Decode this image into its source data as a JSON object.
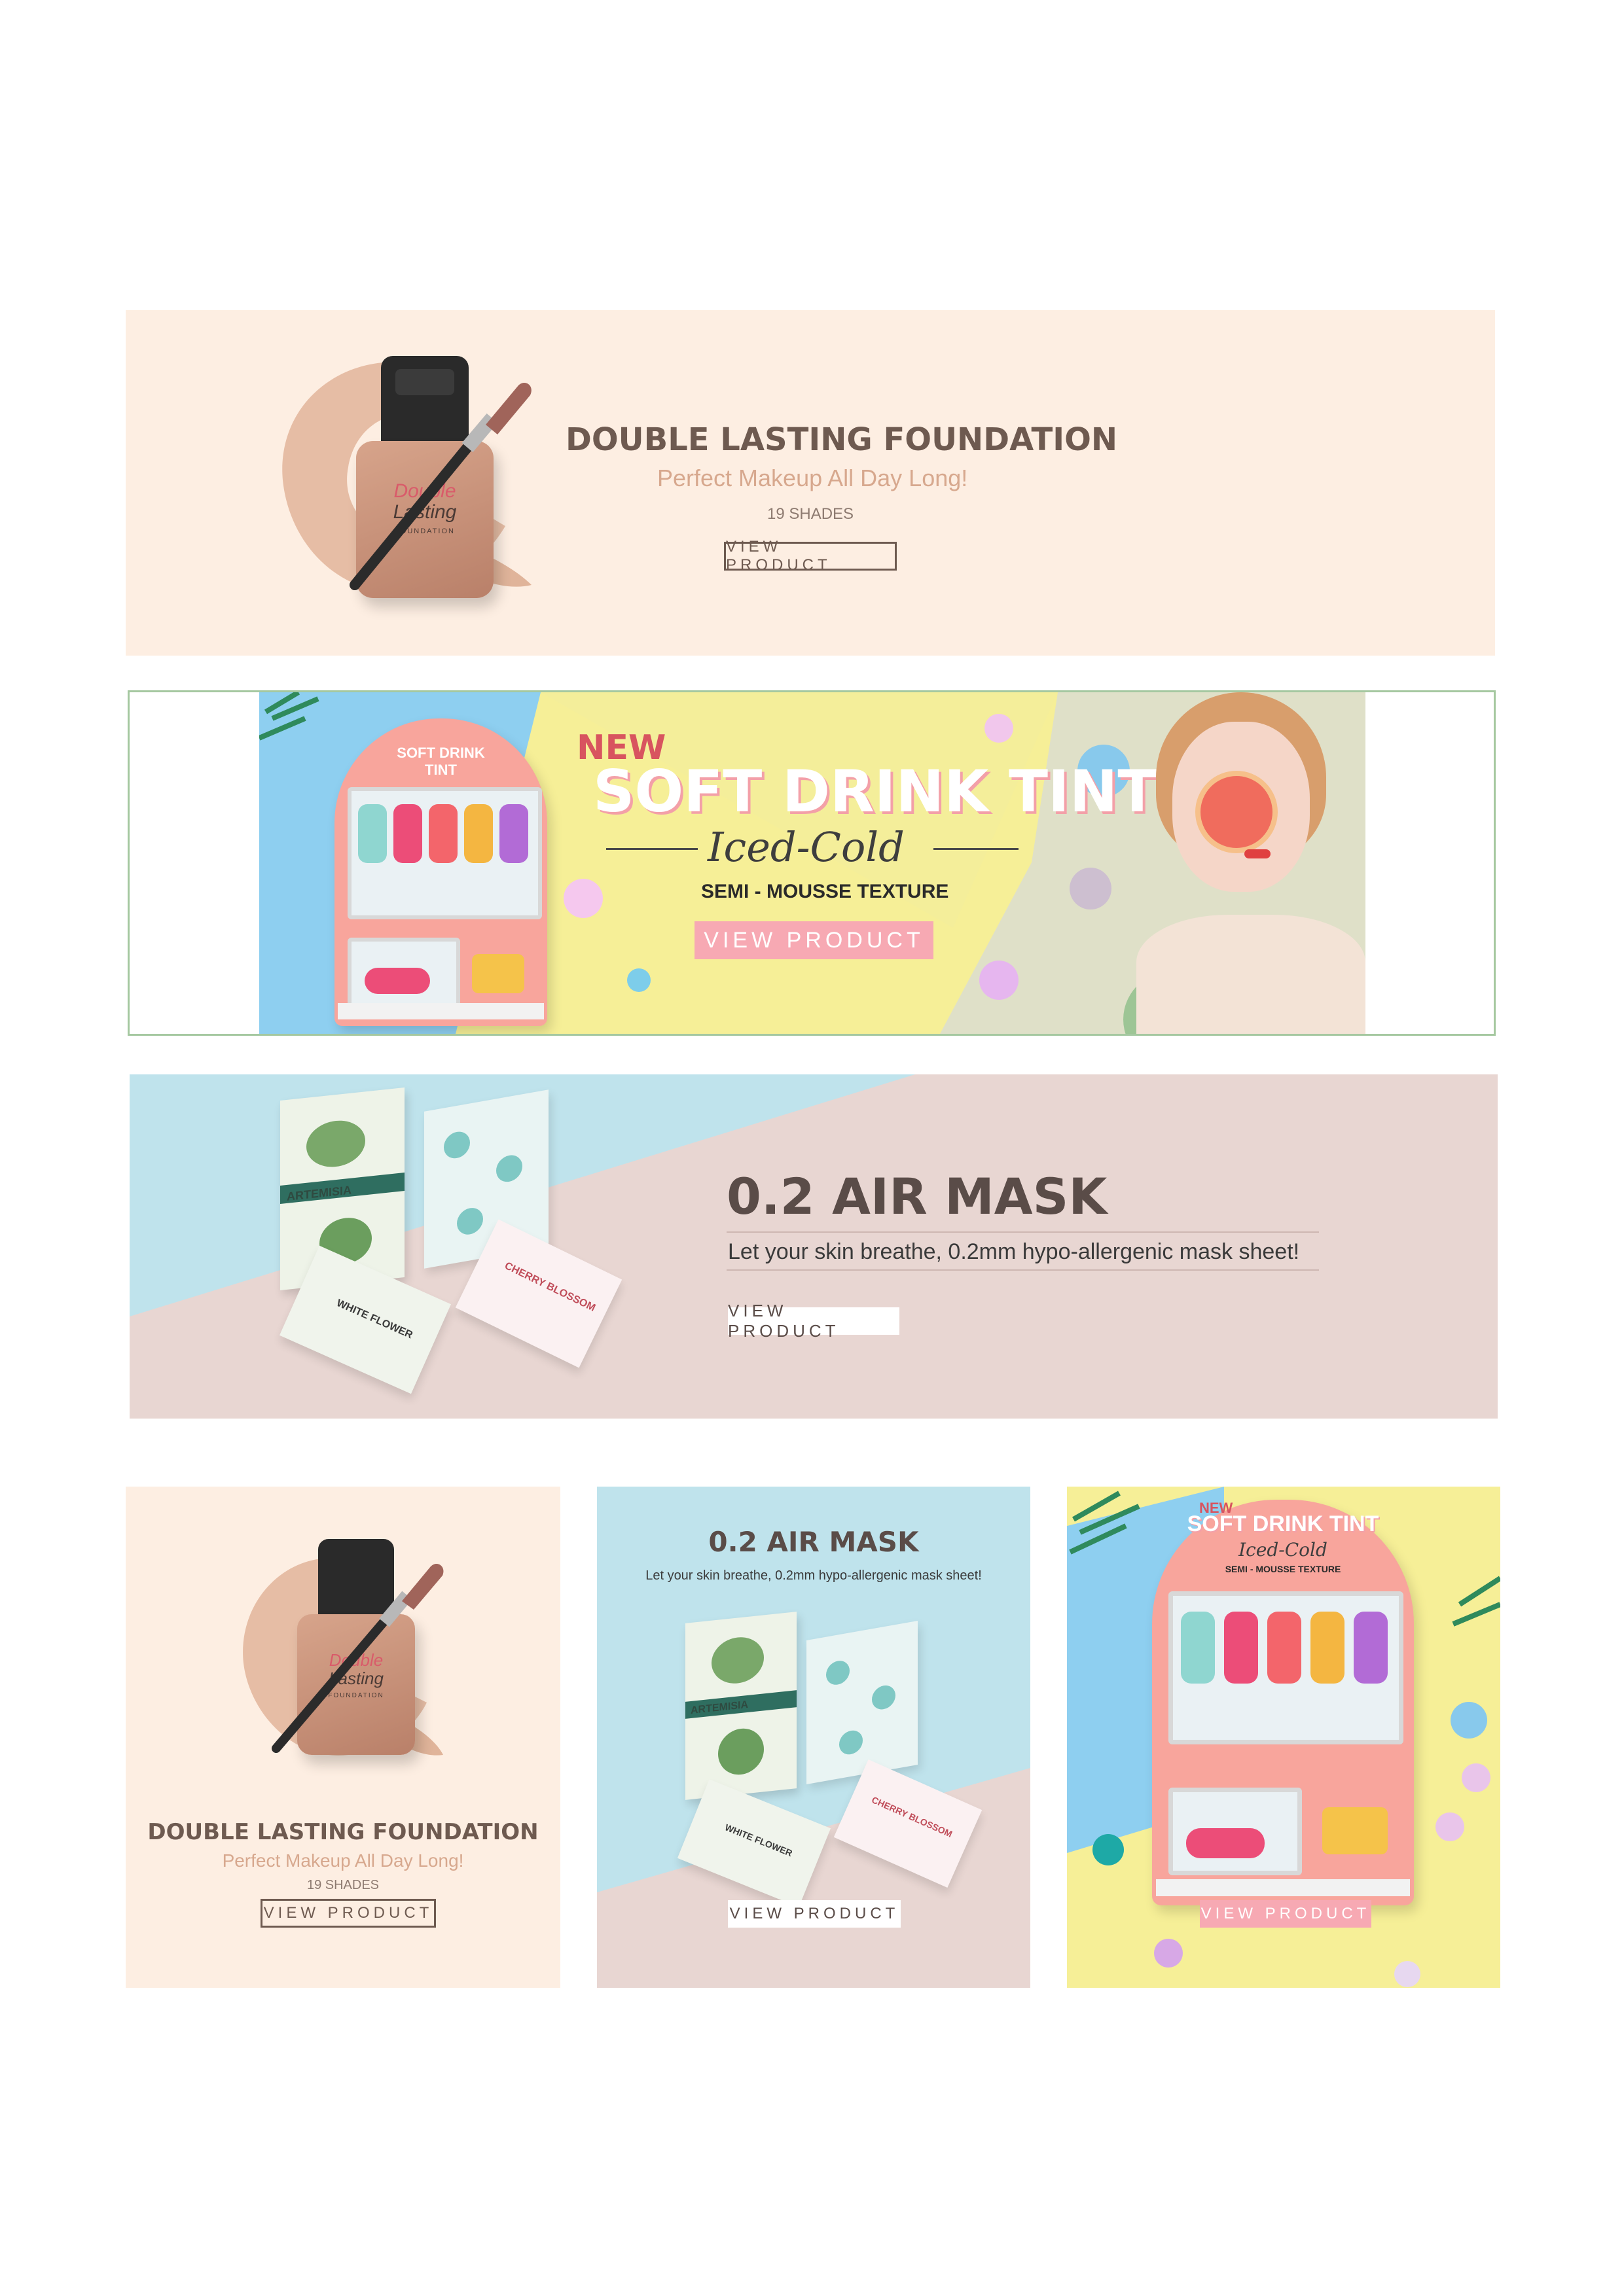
{
  "banners": {
    "foundation_wide": {
      "title": "DOUBLE LASTING FOUNDATION",
      "subtitle": "Perfect Makeup All Day Long!",
      "shades": "19 SHADES",
      "button": "VIEW PRODUCT",
      "bottle_brand_line1": "Double",
      "bottle_brand_line2": "Lasting",
      "bottle_label": "FOUNDATION"
    },
    "tint_wide": {
      "badge": "NEW",
      "title": "SOFT DRINK TINT",
      "script": "Iced-Cold",
      "texture": "SEMI - MOUSSE TEXTURE",
      "button": "VIEW PRODUCT",
      "machine_title": "SOFT DRINK TINT"
    },
    "mask_wide": {
      "title": "0.2 AIR MASK",
      "subtitle": "Let your skin breathe, 0.2mm hypo-allergenic mask sheet!",
      "button": "VIEW PRODUCT",
      "pack_labels": [
        "ARTEMISIA",
        "WHITE FLOWER",
        "CHERRY BLOSSOM"
      ]
    },
    "foundation_square": {
      "title": "DOUBLE LASTING FOUNDATION",
      "subtitle": "Perfect Makeup All Day Long!",
      "shades": "19 SHADES",
      "button": "VIEW PRODUCT",
      "bottle_brand_line1": "Double",
      "bottle_brand_line2": "Lasting",
      "bottle_label": "FOUNDATION"
    },
    "mask_square": {
      "title": "0.2 AIR MASK",
      "subtitle": "Let your skin breathe, 0.2mm hypo-allergenic mask sheet!",
      "button": "VIEW PRODUCT",
      "pack_labels": [
        "ARTEMISIA",
        "WHITE FLOWER",
        "CHERRY BLOSSOM"
      ]
    },
    "tint_square": {
      "badge": "NEW",
      "title": "SOFT DRINK TINT",
      "script": "Iced-Cold",
      "texture": "SEMI - MOUSSE TEXTURE",
      "button": "VIEW PRODUCT"
    }
  },
  "colors": {
    "foundation_bg": "#fdeee2",
    "mask_blue": "#bfe3ec",
    "mask_pink": "#e8d6d2",
    "tint_blue": "#8ccdf0",
    "tint_yellow": "#f7f08d",
    "tint_pink": "#f7a9b3",
    "machine_pink": "#f8a59c"
  }
}
